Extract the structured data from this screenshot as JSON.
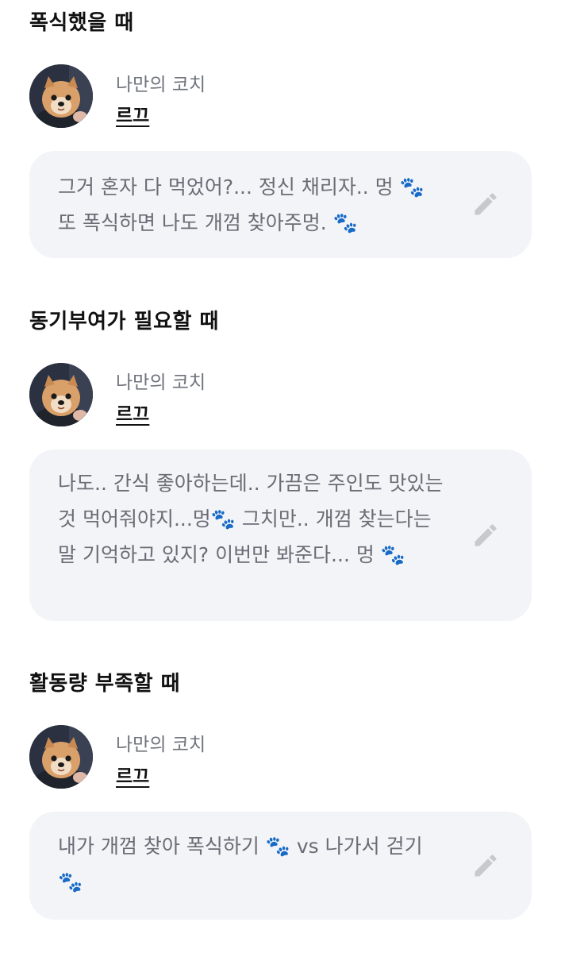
{
  "sections": [
    {
      "title": "폭식했을 때",
      "coach_label": "나만의 코치",
      "coach_name": "르끄",
      "message": "그거 혼자 다 먹었어?... 정신 채리자.. 멍 🐾 또 폭식하면 나도 개껌 찾아주멍. 🐾"
    },
    {
      "title": "동기부여가 필요할 때",
      "coach_label": "나만의 코치",
      "coach_name": "르끄",
      "message": "나도.. 간식 좋아하는데.. 가끔은 주인도 맛있는 것 먹어줘야지...멍🐾 그치만.. 개껌 찾는다는 말 기억하고 있지? 이번만 봐준다... 멍 🐾"
    },
    {
      "title": "활동량 부족할 때",
      "coach_label": "나만의 코치",
      "coach_name": "르끄",
      "message": "내가 개껌 찾아 폭식하기 🐾 vs 나가서 걷기 🐾"
    }
  ],
  "icons": {
    "avatar": "pomeranian-dog-photo",
    "edit": "pencil-icon"
  },
  "colors": {
    "bubble_bg": "#f3f4f8",
    "message_text": "#686c74",
    "coach_label_text": "#6f737b",
    "edit_icon": "#c7c9cf"
  }
}
